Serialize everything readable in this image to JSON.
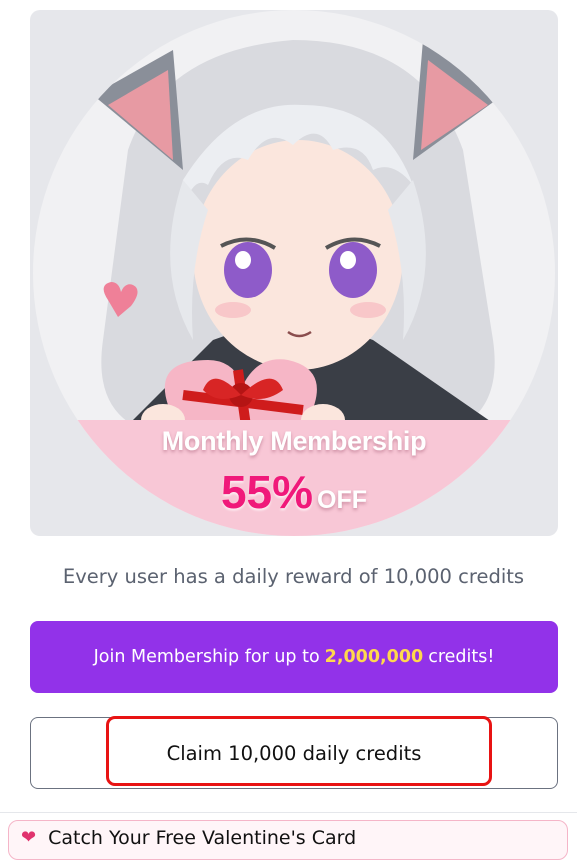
{
  "promo": {
    "title": "Monthly Membership",
    "discount_percent": "55%",
    "discount_suffix": "OFF"
  },
  "reward_text": "Every user has a daily reward of 10,000 credits",
  "join_button": {
    "prefix": "Join Membership for up to",
    "amount": "2,000,000",
    "suffix": "credits!"
  },
  "claim_button": {
    "label": "Claim 10,000 daily credits"
  },
  "footer_tip": {
    "label": "Catch Your Free Valentine's Card"
  },
  "colors": {
    "join_button_bg": "#9232e9",
    "amount_highlight": "#ffd84d",
    "discount_pink": "#f0197a",
    "promo_band": "#f8c7d6",
    "highlight_box": "#e81313"
  },
  "icons": {
    "heart": "heart-icon",
    "gift": "gift-box-icon"
  }
}
